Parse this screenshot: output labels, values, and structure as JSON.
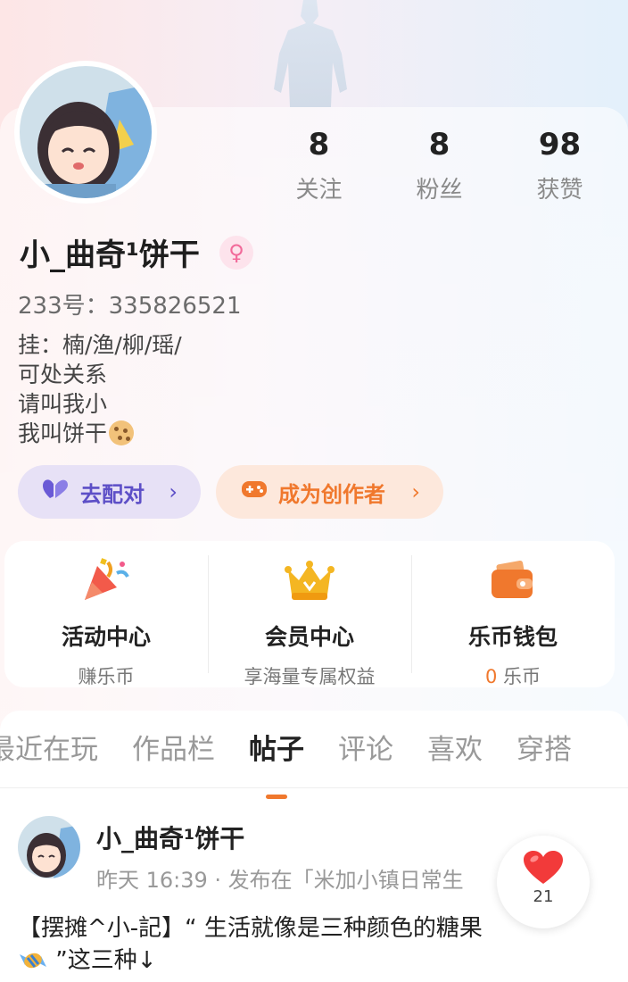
{
  "profile": {
    "stats": [
      {
        "value": "8",
        "label": "关注"
      },
      {
        "value": "8",
        "label": "粉丝"
      },
      {
        "value": "98",
        "label": "获赞"
      }
    ],
    "username": "小_曲奇¹饼干",
    "gender_icon": "♀",
    "uid": "233号：335826521",
    "bio": [
      "挂：楠/渔/柳/瑶/",
      "可处关系",
      "请叫我小",
      "我叫饼干"
    ]
  },
  "actions": {
    "match_label": "去配对",
    "creator_label": "成为创作者",
    "chevron": "›"
  },
  "services": [
    {
      "title": "活动中心",
      "sub": "赚乐币"
    },
    {
      "title": "会员中心",
      "sub": "享海量专属权益"
    },
    {
      "title": "乐币钱包",
      "sub_value": "0",
      "sub_unit": " 乐币"
    }
  ],
  "tabs": [
    "最近在玩",
    "作品栏",
    "帖子",
    "评论",
    "喜欢",
    "穿搭"
  ],
  "active_tab": "帖子",
  "post": {
    "author": "小_曲奇¹饼干",
    "meta": "昨天 16:39 · 发布在「米加小镇日常生",
    "text_line1": "【摆摊^小-記】“ 生活就像是三种颜色的糖果",
    "text_line2": " ”这三种↓",
    "likes": "21"
  },
  "colors": {
    "accent_orange": "#f0782d",
    "accent_purple": "#5d4fc7",
    "gender_pink": "#f26a9a",
    "like_red": "#f23a3a"
  }
}
